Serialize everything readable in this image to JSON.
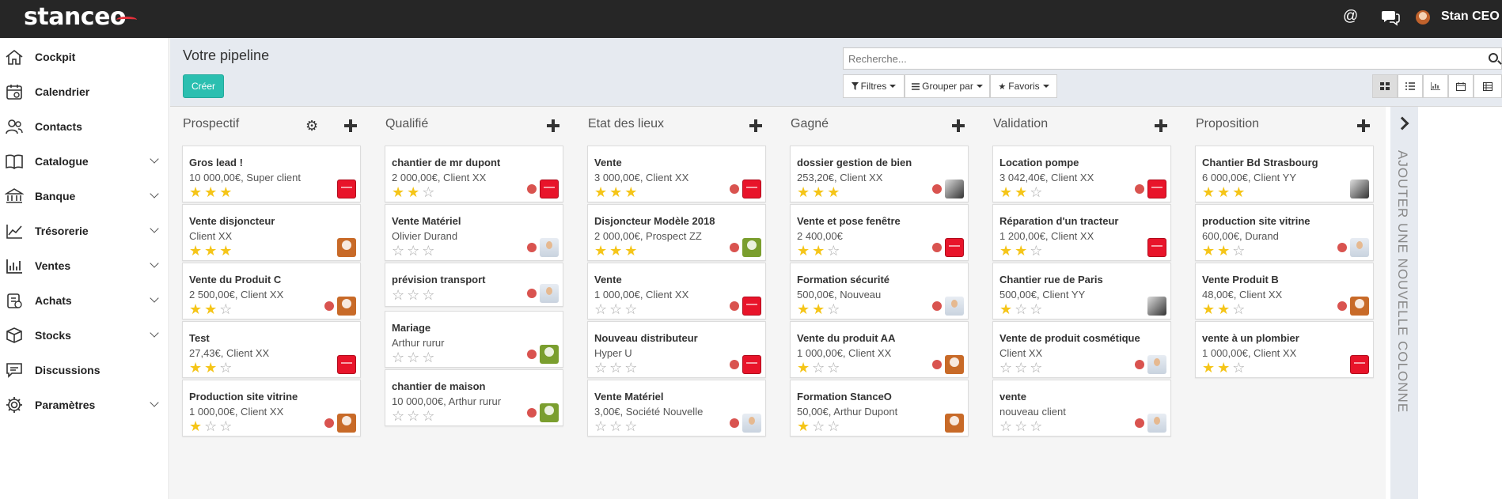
{
  "app": {
    "brand": "stanceo"
  },
  "topbar": {
    "at_icon": "@",
    "user_name": "Stan CEO"
  },
  "sidebar": {
    "items": [
      {
        "label": "Cockpit",
        "icon": "home-icon",
        "expandable": false
      },
      {
        "label": "Calendrier",
        "icon": "calendar-icon",
        "expandable": false
      },
      {
        "label": "Contacts",
        "icon": "contacts-icon",
        "expandable": false
      },
      {
        "label": "Catalogue",
        "icon": "book-icon",
        "expandable": true
      },
      {
        "label": "Banque",
        "icon": "bank-icon",
        "expandable": true
      },
      {
        "label": "Trésorerie",
        "icon": "chart-line-icon",
        "expandable": true
      },
      {
        "label": "Ventes",
        "icon": "bar-chart-icon",
        "expandable": true
      },
      {
        "label": "Achats",
        "icon": "clipboard-icon",
        "expandable": true
      },
      {
        "label": "Stocks",
        "icon": "box-icon",
        "expandable": true
      },
      {
        "label": "Discussions",
        "icon": "chat-icon",
        "expandable": false
      },
      {
        "label": "Paramètres",
        "icon": "gear-icon",
        "expandable": true
      }
    ]
  },
  "control": {
    "title": "Votre pipeline",
    "create_label": "Créer",
    "search_placeholder": "Recherche...",
    "filters_label": "Filtres",
    "group_label": "Grouper par",
    "favorites_label": "Favoris"
  },
  "columns": [
    {
      "title": "Prospectif",
      "has_gear": true,
      "cards": [
        {
          "title": "Gros lead !",
          "sub": "10 000,00€, Super client",
          "stars": 3,
          "dot": false,
          "avatar": "red"
        },
        {
          "title": "Vente disjoncteur",
          "sub": "Client XX",
          "stars": 3,
          "dot": false,
          "avatar": "orange"
        },
        {
          "title": "Vente du Produit C",
          "sub": "2 500,00€, Client XX",
          "stars": 2,
          "dot": true,
          "avatar": "orange"
        },
        {
          "title": "Test",
          "sub": "27,43€, Client XX",
          "stars": 2,
          "dot": false,
          "avatar": "red"
        },
        {
          "title": "Production site vitrine",
          "sub": "1 000,00€, Client XX",
          "stars": 1,
          "dot": true,
          "avatar": "orange"
        }
      ]
    },
    {
      "title": "Qualifié",
      "has_gear": false,
      "cards": [
        {
          "title": "chantier de mr dupont",
          "sub": "2 000,00€, Client XX",
          "stars": 2,
          "dot": true,
          "avatar": "red"
        },
        {
          "title": "Vente Matériel",
          "sub": "Olivier Durand",
          "stars": 0,
          "dot": true,
          "avatar": "kid"
        },
        {
          "title": "prévision transport",
          "sub": "",
          "stars": 0,
          "dot": true,
          "avatar": "kid"
        },
        {
          "title": "Mariage",
          "sub": "Arthur rurur",
          "stars": 0,
          "dot": true,
          "avatar": "green"
        },
        {
          "title": "chantier de maison",
          "sub": "10 000,00€, Arthur rurur",
          "stars": 0,
          "dot": true,
          "avatar": "green"
        }
      ]
    },
    {
      "title": "Etat des lieux",
      "has_gear": false,
      "cards": [
        {
          "title": "Vente",
          "sub": "3 000,00€, Client XX",
          "stars": 3,
          "dot": true,
          "avatar": "red"
        },
        {
          "title": "Disjoncteur Modèle 2018",
          "sub": "2 000,00€, Prospect ZZ",
          "stars": 3,
          "dot": true,
          "avatar": "green"
        },
        {
          "title": "Vente",
          "sub": "1 000,00€, Client XX",
          "stars": 0,
          "dot": true,
          "avatar": "red"
        },
        {
          "title": "Nouveau distributeur",
          "sub": "Hyper U",
          "stars": 0,
          "dot": true,
          "avatar": "red"
        },
        {
          "title": "Vente Matériel",
          "sub": "3,00€, Société Nouvelle",
          "stars": 0,
          "dot": true,
          "avatar": "kid"
        }
      ]
    },
    {
      "title": "Gagné",
      "has_gear": false,
      "cards": [
        {
          "title": "dossier gestion de bien",
          "sub": "253,20€, Client XX",
          "stars": 3,
          "dot": true,
          "avatar": "photo"
        },
        {
          "title": "Vente et pose fenêtre",
          "sub": "2 400,00€",
          "stars": 2,
          "dot": true,
          "avatar": "red"
        },
        {
          "title": "Formation sécurité",
          "sub": "500,00€, Nouveau",
          "stars": 2,
          "dot": true,
          "avatar": "kid"
        },
        {
          "title": "Vente du produit AA",
          "sub": "1 000,00€, Client XX",
          "stars": 1,
          "dot": true,
          "avatar": "orange"
        },
        {
          "title": "Formation StanceO",
          "sub": "50,00€, Arthur Dupont",
          "stars": 1,
          "dot": false,
          "avatar": "orange"
        }
      ]
    },
    {
      "title": "Validation",
      "has_gear": false,
      "cards": [
        {
          "title": "Location pompe",
          "sub": "3 042,40€, Client XX",
          "stars": 2,
          "dot": true,
          "avatar": "red"
        },
        {
          "title": "Réparation d'un tracteur",
          "sub": "1 200,00€, Client XX",
          "stars": 2,
          "dot": false,
          "avatar": "red"
        },
        {
          "title": "Chantier rue de Paris",
          "sub": "500,00€, Client YY",
          "stars": 1,
          "dot": false,
          "avatar": "photo"
        },
        {
          "title": "Vente de produit cosmétique",
          "sub": "Client XX",
          "stars": 0,
          "dot": true,
          "avatar": "kid"
        },
        {
          "title": "vente",
          "sub": "nouveau client",
          "stars": 0,
          "dot": true,
          "avatar": "kid"
        }
      ]
    },
    {
      "title": "Proposition",
      "has_gear": false,
      "cards": [
        {
          "title": "Chantier Bd Strasbourg",
          "sub": "6 000,00€, Client YY",
          "stars": 3,
          "dot": false,
          "avatar": "photo"
        },
        {
          "title": "production site vitrine",
          "sub": "600,00€, Durand",
          "stars": 2,
          "dot": true,
          "avatar": "kid"
        },
        {
          "title": "Vente Produit B",
          "sub": "48,00€, Client XX",
          "stars": 2,
          "dot": true,
          "avatar": "orange"
        },
        {
          "title": "vente à un plombier",
          "sub": "1 000,00€, Client XX",
          "stars": 2,
          "dot": false,
          "avatar": "red"
        }
      ]
    }
  ],
  "add_column_label": "AJOUTER UNE NOUVELLE COLONNE"
}
